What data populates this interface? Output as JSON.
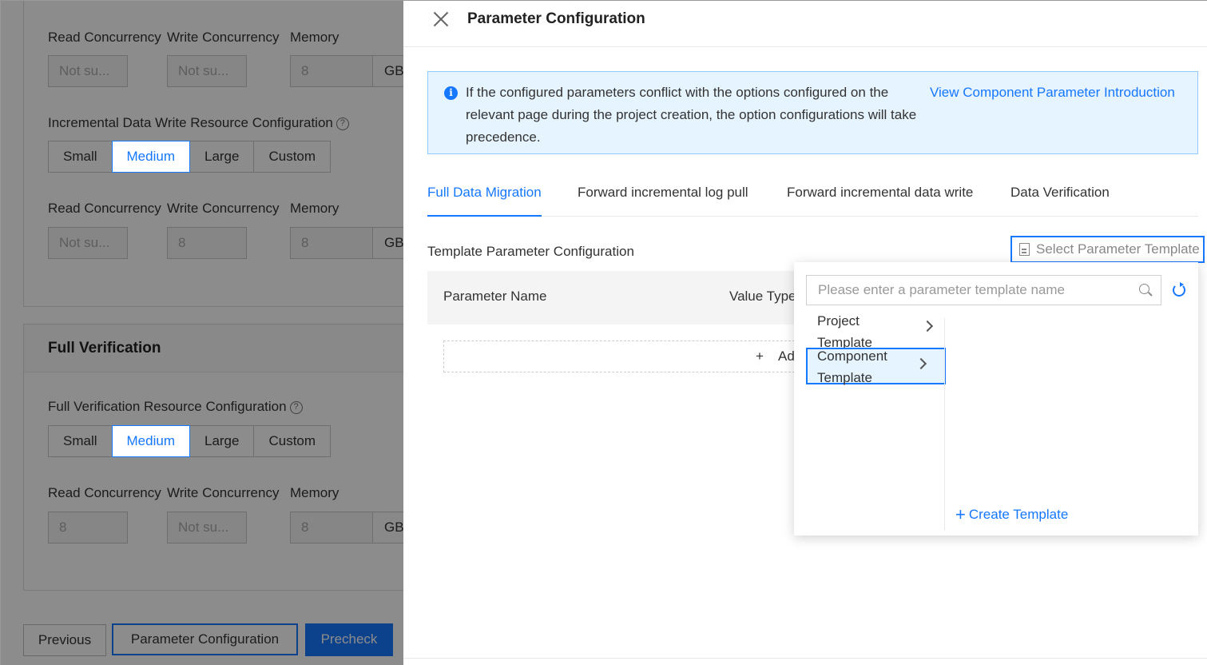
{
  "background": {
    "row1": {
      "labels": [
        "Read Concurrency",
        "Write Concurrency",
        "Memory"
      ],
      "read": "Not su...",
      "write": "Not su...",
      "memory": "8",
      "unit": "GB"
    },
    "incremental": {
      "title": "Incremental Data Write Resource Configuration",
      "options": [
        "Small",
        "Medium",
        "Large",
        "Custom"
      ],
      "selected": "Medium",
      "labels": [
        "Read Concurrency",
        "Write Concurrency",
        "Memory"
      ],
      "read": "Not su...",
      "write": "8",
      "memory": "8",
      "unit": "GB"
    },
    "full_verification": {
      "header": "Full Verification",
      "title": "Full Verification Resource Configuration",
      "options": [
        "Small",
        "Medium",
        "Large",
        "Custom"
      ],
      "selected": "Medium",
      "labels": [
        "Read Concurrency",
        "Write Concurrency",
        "Memory"
      ],
      "read": "8",
      "write": "Not su...",
      "memory": "8",
      "unit": "GB"
    },
    "footer": {
      "previous": "Previous",
      "param_config": "Parameter Configuration",
      "precheck": "Precheck"
    },
    "help_glyph": "?"
  },
  "drawer": {
    "title": "Parameter Configuration",
    "info": {
      "icon_glyph": "i",
      "text": "If the configured parameters conflict with the options configured on the relevant page during the project creation, the option configurations will take precedence.",
      "link": "View Component Parameter Introduction"
    },
    "tabs": [
      {
        "label": "Full Data Migration",
        "active": true
      },
      {
        "label": "Forward incremental log pull",
        "active": false
      },
      {
        "label": "Forward incremental data write",
        "active": false
      },
      {
        "label": "Data Verification",
        "active": false
      }
    ],
    "template_section_label": "Template Parameter Configuration",
    "select_template_button": "Select Parameter Template",
    "table": {
      "columns": [
        "Parameter Name",
        "Value Type"
      ],
      "add_label": "Ad",
      "add_glyph": "+"
    },
    "dropdown": {
      "search_placeholder": "Please enter a parameter template name",
      "categories": [
        {
          "label": "Project Template",
          "selected": false
        },
        {
          "label": "Component Template",
          "selected": true
        }
      ],
      "create_label": "Create Template",
      "create_glyph": "+"
    }
  },
  "colors": {
    "accent": "#1677ff",
    "info_bg": "#e6f4ff",
    "overlay": "rgba(0,0,0,0.45)"
  }
}
